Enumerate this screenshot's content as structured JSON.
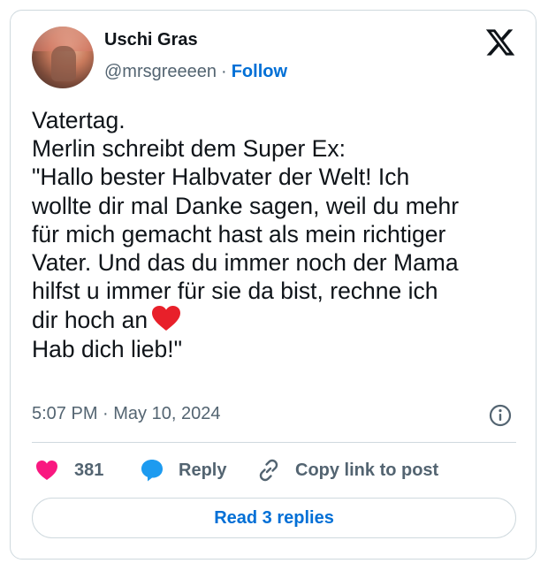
{
  "author": {
    "name": "Uschi Gras",
    "handle": "@mrsgreeeen",
    "separator": "·",
    "follow_label": "Follow"
  },
  "tweet": {
    "lines": [
      "Vatertag.",
      "Merlin schreibt dem Super Ex:",
      "\"Hallo bester Halbvater der Welt! Ich",
      "wollte dir mal Danke sagen, weil du mehr",
      "für mich gemacht hast als mein richtiger",
      "Vater. Und das du immer noch der Mama",
      "hilfst u immer für sie da bist, rechne ich",
      "dir hoch an",
      "Hab dich lieb!\""
    ]
  },
  "meta": {
    "timestamp": "5:07 PM · May 10, 2024"
  },
  "actions": {
    "like_count": "381",
    "reply_label": "Reply",
    "copy_label": "Copy link to post"
  },
  "read_replies": {
    "label": "Read 3 replies"
  },
  "icons": {
    "logo": "x-logo-icon",
    "info": "info-icon",
    "like": "heart-icon",
    "reply": "speech-bubble-icon",
    "copy": "link-icon",
    "emoji": "red-heart-emoji-icon"
  },
  "colors": {
    "link": "#006fd6",
    "like": "#f91880",
    "reply": "#1d9bf0",
    "emoji": "#e8202a",
    "muted": "#536471",
    "border": "#cfd9de"
  }
}
